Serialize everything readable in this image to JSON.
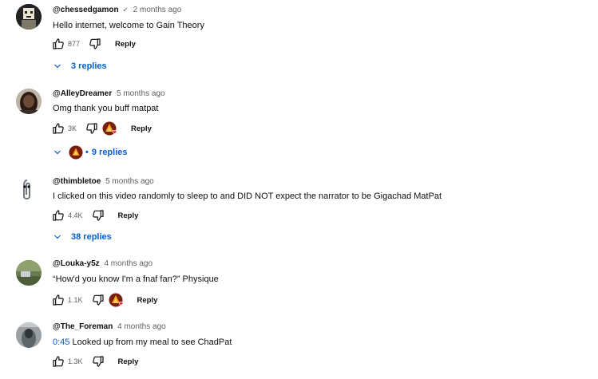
{
  "comments": [
    {
      "author": "@chessedgamon",
      "verified_mark": "✓",
      "time": "2 months ago",
      "text": "Hello internet, welcome to Gain Theory",
      "likes": "877",
      "reply_label": "Reply",
      "replies_label": "3 replies"
    },
    {
      "author": "@AlleyDreamer",
      "time": "5 months ago",
      "text": "Omg thank you buff matpat",
      "likes": "3K",
      "reply_label": "Reply",
      "replies_label": "9 replies",
      "replies_separator": "•"
    },
    {
      "author": "@thimbletoe",
      "time": "5 months ago",
      "text": "I clicked on this video randomly to sleep to and DID NOT expect the narrator to be Gigachad MatPat",
      "likes": "4.4K",
      "reply_label": "Reply",
      "replies_label": "38 replies"
    },
    {
      "author": "@Louka-y5z",
      "time": "4 months ago",
      "text": "“How'd you know I'm a fnaf fan?” Physique",
      "likes": "1.1K",
      "reply_label": "Reply"
    },
    {
      "author": "@The_Foreman",
      "time": "4 months ago",
      "timestamp_link": "0:45",
      "text": "Looked up from my meal to see ChadPat",
      "likes": "1.3K",
      "reply_label": "Reply"
    }
  ],
  "colors": {
    "link": "#065fd4",
    "heart": "#ff0000",
    "muted": "#606060"
  },
  "icons": [
    "thumbs-up-icon",
    "thumbs-down-icon",
    "chevron-down-icon",
    "creator-heart-icon"
  ]
}
